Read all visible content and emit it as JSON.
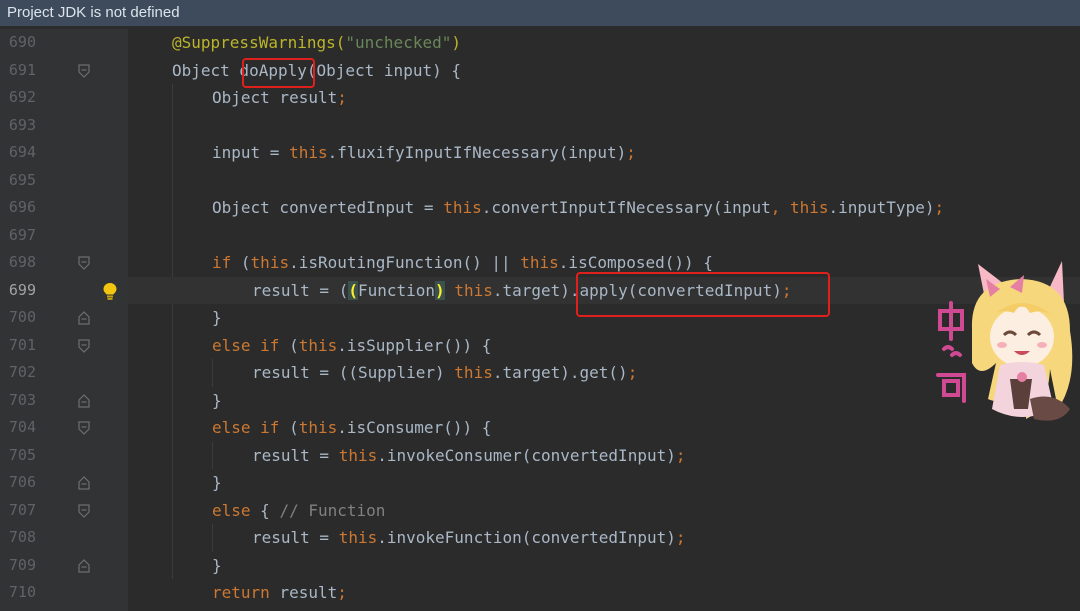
{
  "banner": {
    "text": "Project JDK is not defined"
  },
  "editor": {
    "current_line": 699,
    "lines": [
      {
        "num": "690",
        "indent": 1,
        "segments": [
          {
            "t": "@SuppressWarnings(",
            "c": "ann"
          },
          {
            "t": "\"unchecked\"",
            "c": "str"
          },
          {
            "t": ")",
            "c": "ann"
          }
        ]
      },
      {
        "num": "691",
        "indent": 1,
        "segments": [
          {
            "t": "Object doApply(Object input) {",
            "c": "plain"
          }
        ]
      },
      {
        "num": "692",
        "indent": 2,
        "segments": [
          {
            "t": "Object result",
            "c": "plain"
          },
          {
            "t": ";",
            "c": "kw"
          }
        ]
      },
      {
        "num": "693",
        "indent": 0,
        "segments": []
      },
      {
        "num": "694",
        "indent": 2,
        "segments": [
          {
            "t": "input = ",
            "c": "plain"
          },
          {
            "t": "this",
            "c": "kw"
          },
          {
            "t": ".fluxifyInputIfNecessary(input)",
            "c": "plain"
          },
          {
            "t": ";",
            "c": "kw"
          }
        ]
      },
      {
        "num": "695",
        "indent": 0,
        "segments": []
      },
      {
        "num": "696",
        "indent": 2,
        "segments": [
          {
            "t": "Object convertedInput = ",
            "c": "plain"
          },
          {
            "t": "this",
            "c": "kw"
          },
          {
            "t": ".convertInputIfNecessary(input",
            "c": "plain"
          },
          {
            "t": ", ",
            "c": "kw"
          },
          {
            "t": "this",
            "c": "kw"
          },
          {
            "t": ".inputType)",
            "c": "plain"
          },
          {
            "t": ";",
            "c": "kw"
          }
        ]
      },
      {
        "num": "697",
        "indent": 0,
        "segments": []
      },
      {
        "num": "698",
        "indent": 2,
        "segments": [
          {
            "t": "if ",
            "c": "kw"
          },
          {
            "t": "(",
            "c": "plain"
          },
          {
            "t": "this",
            "c": "kw"
          },
          {
            "t": ".isRoutingFunction() || ",
            "c": "plain"
          },
          {
            "t": "this",
            "c": "kw"
          },
          {
            "t": ".isComposed()) {",
            "c": "plain"
          }
        ]
      },
      {
        "num": "699",
        "indent": 3,
        "segments": [
          {
            "t": "result = (",
            "c": "plain"
          },
          {
            "t": "(",
            "c": "match"
          },
          {
            "t": "Function",
            "c": "plain"
          },
          {
            "t": ")",
            "c": "match"
          },
          {
            "t": " ",
            "c": "plain"
          },
          {
            "t": "this",
            "c": "kw"
          },
          {
            "t": ".target).apply(convertedInput)",
            "c": "plain"
          },
          {
            "t": ";",
            "c": "kw"
          }
        ]
      },
      {
        "num": "700",
        "indent": 2,
        "segments": [
          {
            "t": "}",
            "c": "plain"
          }
        ]
      },
      {
        "num": "701",
        "indent": 2,
        "segments": [
          {
            "t": "else if ",
            "c": "kw"
          },
          {
            "t": "(",
            "c": "plain"
          },
          {
            "t": "this",
            "c": "kw"
          },
          {
            "t": ".isSupplier()) {",
            "c": "plain"
          }
        ]
      },
      {
        "num": "702",
        "indent": 3,
        "segments": [
          {
            "t": "result = ((Supplier) ",
            "c": "plain"
          },
          {
            "t": "this",
            "c": "kw"
          },
          {
            "t": ".target).get()",
            "c": "plain"
          },
          {
            "t": ";",
            "c": "kw"
          }
        ]
      },
      {
        "num": "703",
        "indent": 2,
        "segments": [
          {
            "t": "}",
            "c": "plain"
          }
        ]
      },
      {
        "num": "704",
        "indent": 2,
        "segments": [
          {
            "t": "else if ",
            "c": "kw"
          },
          {
            "t": "(",
            "c": "plain"
          },
          {
            "t": "this",
            "c": "kw"
          },
          {
            "t": ".isConsumer()) {",
            "c": "plain"
          }
        ]
      },
      {
        "num": "705",
        "indent": 3,
        "segments": [
          {
            "t": "result = ",
            "c": "plain"
          },
          {
            "t": "this",
            "c": "kw"
          },
          {
            "t": ".invokeConsumer(convertedInput)",
            "c": "plain"
          },
          {
            "t": ";",
            "c": "kw"
          }
        ]
      },
      {
        "num": "706",
        "indent": 2,
        "segments": [
          {
            "t": "}",
            "c": "plain"
          }
        ]
      },
      {
        "num": "707",
        "indent": 2,
        "segments": [
          {
            "t": "else ",
            "c": "kw"
          },
          {
            "t": "{ ",
            "c": "plain"
          },
          {
            "t": "// Function",
            "c": "cm"
          }
        ]
      },
      {
        "num": "708",
        "indent": 3,
        "segments": [
          {
            "t": "result = ",
            "c": "plain"
          },
          {
            "t": "this",
            "c": "kw"
          },
          {
            "t": ".invokeFunction(convertedInput)",
            "c": "plain"
          },
          {
            "t": ";",
            "c": "kw"
          }
        ]
      },
      {
        "num": "709",
        "indent": 2,
        "segments": [
          {
            "t": "}",
            "c": "plain"
          }
        ]
      },
      {
        "num": "710",
        "indent": 2,
        "segments": [
          {
            "t": "return ",
            "c": "kw"
          },
          {
            "t": "result",
            "c": "plain"
          },
          {
            "t": ";",
            "c": "kw"
          }
        ]
      }
    ],
    "fold_markers": {
      "691": "fold-start-icon",
      "698": "fold-start-icon",
      "700": "fold-end-icon",
      "701": "fold-start-icon",
      "703": "fold-end-icon",
      "704": "fold-start-icon",
      "706": "fold-end-icon",
      "707": "fold-start-icon",
      "709": "fold-end-icon"
    },
    "intention_icon": {
      "line": "699",
      "name": "lightbulb-icon"
    }
  },
  "mascot": {
    "name": "anime-girl-sticker",
    "caption": "中...间"
  },
  "colors": {
    "background": "#2b2b2b",
    "gutter": "#313335",
    "banner": "#3d4b5c",
    "keyword": "#cc7832",
    "string": "#6a8759",
    "annotation": "#bbb529",
    "comment": "#808080",
    "text": "#a9b7c6",
    "highlight_box": "#e0201c"
  }
}
